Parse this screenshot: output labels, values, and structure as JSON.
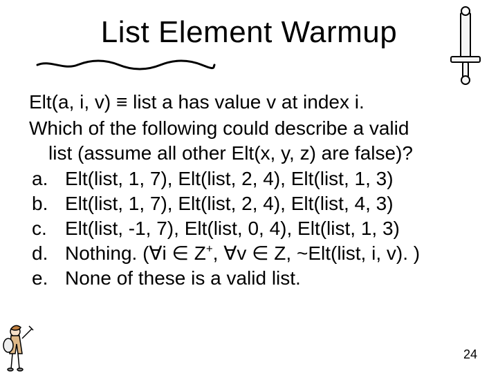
{
  "title": "List Element Warmup",
  "definition": "Elt(a, i, v) ≡ list a has value v at index i.",
  "question_line1": "Which of the following could describe a valid",
  "question_line2": "list (assume all other Elt(x, y, z) are false)?",
  "options": {
    "a": {
      "letter": "a.",
      "text": "Elt(list, 1, 7), Elt(list, 2, 4), Elt(list, 1, 3)"
    },
    "b": {
      "letter": "b.",
      "text": "Elt(list, 1, 7), Elt(list, 2, 4), Elt(list, 4, 3)"
    },
    "c": {
      "letter": "c.",
      "text": "Elt(list, -1, 7), Elt(list, 0, 4), Elt(list, 1, 3)"
    },
    "d": {
      "letter": "d.",
      "text_html": "Nothing. (∀i ∈ Z<sup>+</sup>, ∀v ∈ Z, ~Elt(list, i, v). )"
    },
    "e": {
      "letter": "e.",
      "text": "None of these is a valid list."
    }
  },
  "page_number": "24",
  "icons": {
    "sword": "sword-icon",
    "underline": "squiggle-underline-icon",
    "warrior": "warrior-figure-icon"
  }
}
